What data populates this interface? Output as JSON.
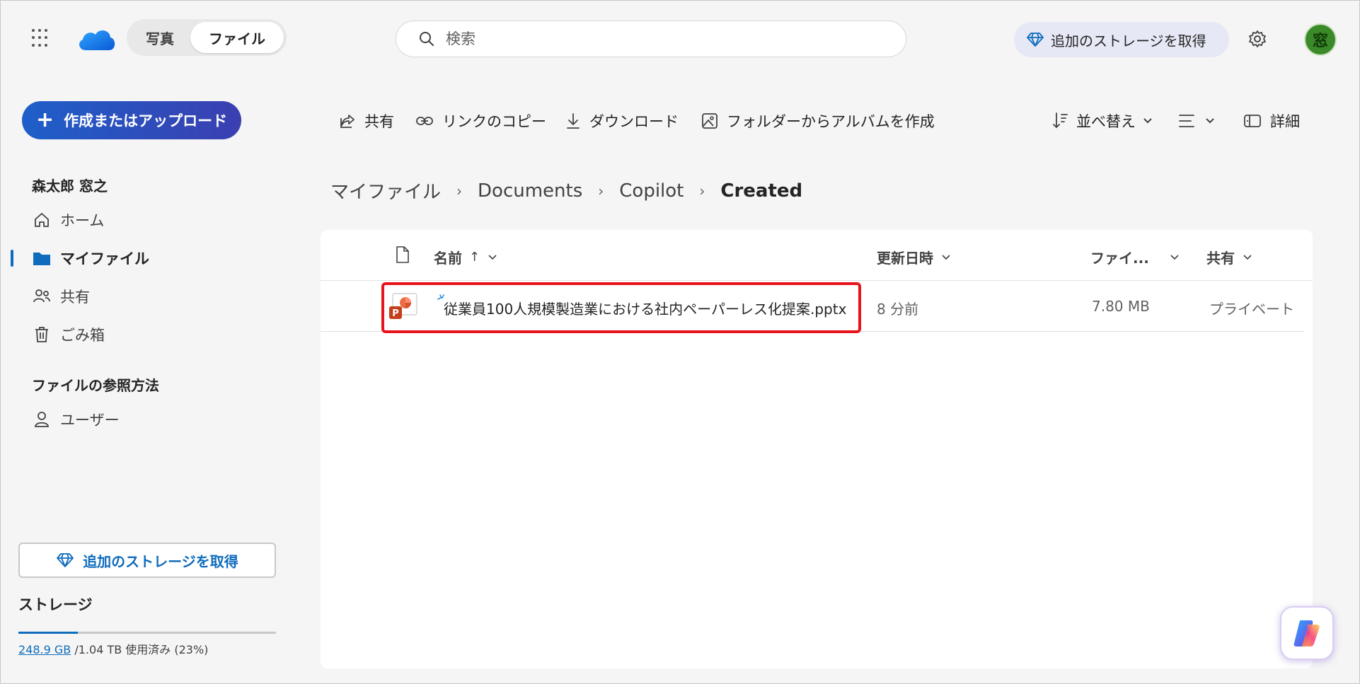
{
  "topbar": {
    "tabs": [
      {
        "label": "写真"
      },
      {
        "label": "ファイル"
      }
    ],
    "search_placeholder": "検索",
    "storage_label": "追加のストレージを取得",
    "avatar_initial": "窓"
  },
  "sidebar": {
    "create_label": "作成またはアップロード",
    "user_name": "森太郎 窓之",
    "items": [
      {
        "label": "ホーム",
        "icon": "home-icon"
      },
      {
        "label": "マイファイル",
        "icon": "folder-icon"
      },
      {
        "label": "共有",
        "icon": "people-icon"
      },
      {
        "label": "ごみ箱",
        "icon": "trash-icon"
      }
    ],
    "browse_heading": "ファイルの参照方法",
    "browse_items": [
      {
        "label": "ユーザー",
        "icon": "person-icon"
      }
    ],
    "storage_button": "追加のストレージを取得",
    "storage_title": "ストレージ",
    "storage_used": "248.9 GB",
    "storage_rest": " /1.04 TB 使用済み (23%)",
    "storage_fraction": 0.23
  },
  "commands": {
    "share": "共有",
    "copy_link": "リンクのコピー",
    "download": "ダウンロード",
    "album": "フォルダーからアルバムを作成",
    "sort": "並べ替え",
    "details": "詳細"
  },
  "breadcrumb": [
    "マイファイル",
    "Documents",
    "Copilot",
    "Created"
  ],
  "table": {
    "headers": {
      "name": "名前",
      "sort_arrow": "↑",
      "modified": "更新日時",
      "size": "ファイ...",
      "sharing": "共有"
    },
    "rows": [
      {
        "name": "従業員100人規模製造業における社内ペーパーレス化提案.pptx",
        "modified": "8 分前",
        "size": "7.80 MB",
        "sharing": "プライベート",
        "icon": "powerpoint-icon"
      }
    ]
  },
  "colors": {
    "accent": "#0f6cbd",
    "highlight": "#e8141c",
    "create_gradient_start": "#1e5fc9",
    "create_gradient_end": "#3b3fb0"
  }
}
